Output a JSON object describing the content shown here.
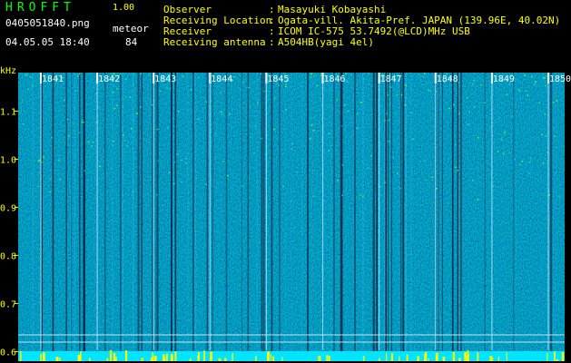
{
  "header": {
    "app_title": "HROFFT",
    "app_version": "1.00",
    "file_name": "0405051840.png",
    "date_time": "04.05.05 18:40",
    "meteor_label": "meteor",
    "meteor_count": "84"
  },
  "info": [
    {
      "label": "Observer",
      "value": "Masayuki Kobayashi"
    },
    {
      "label": "Receiving Location",
      "value": "Ogata-vill. Akita-Pref. JAPAN (139.96E, 40.02N)"
    },
    {
      "label": "Receiver",
      "value": "ICOM IC-575 53.7492(@LCD)MHz USB"
    },
    {
      "label": "Receiving antenna",
      "value": "A504HB(yagi 4el)"
    }
  ],
  "colon": ":",
  "spectrogram": {
    "frequency_unit": "kHz",
    "frequency_ticks": [
      "1.1",
      "1.0",
      "0.9",
      "0.8",
      "0.7",
      "0.6"
    ],
    "frequency_tick_values": [
      1.1,
      1.0,
      0.9,
      0.8,
      0.7,
      0.6
    ],
    "frequency_range": [
      0.58,
      1.18
    ],
    "time_ticks": [
      "1841",
      "1842",
      "1843",
      "1844",
      "1845",
      "1846",
      "1847",
      "1848",
      "1849",
      "1850"
    ],
    "colors": {
      "background": "#0a1a8c",
      "tick_label": "#ffff00",
      "low_band": "#00e5ff",
      "meteor": "#ffff00",
      "text": "#ffffff",
      "title": "#00ff00"
    }
  }
}
